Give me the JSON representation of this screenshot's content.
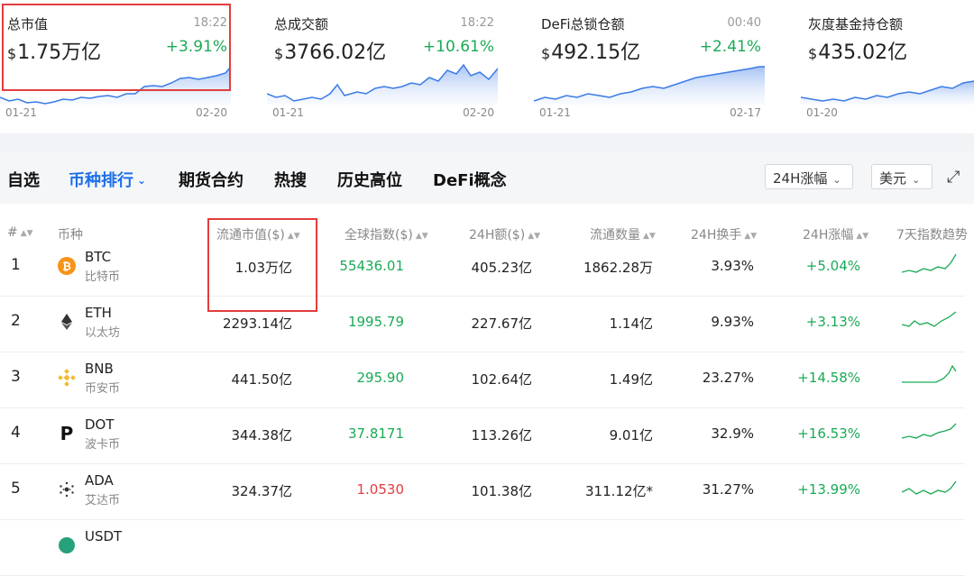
{
  "cards": [
    {
      "title": "总市值",
      "time": "18:22",
      "currency": "$",
      "value": "1.75万亿",
      "change": "+3.91%",
      "date_start": "01-21",
      "date_end": "02-20"
    },
    {
      "title": "总成交额",
      "time": "18:22",
      "currency": "$",
      "value": "3766.02亿",
      "change": "+10.61%",
      "date_start": "01-21",
      "date_end": "02-20"
    },
    {
      "title": "DeFi总锁仓额",
      "time": "00:40",
      "currency": "$",
      "value": "492.15亿",
      "change": "+2.41%",
      "date_start": "01-21",
      "date_end": "02-17"
    },
    {
      "title": "灰度基金持仓额",
      "time": "",
      "currency": "$",
      "value": "435.02亿",
      "change": "",
      "date_start": "01-20",
      "date_end": ""
    }
  ],
  "nav": {
    "tabs": [
      "自选",
      "币种排行",
      "期货合约",
      "热搜",
      "历史高位",
      "DeFi概念"
    ],
    "active_tab": "币种排行",
    "range_select": "24H涨幅",
    "currency_select": "美元"
  },
  "table": {
    "headers": [
      "#",
      "币种",
      "流通市值($)",
      "全球指数($)",
      "24H额($)",
      "流通数量",
      "24H换手",
      "24H涨幅",
      "7天指数趋势"
    ],
    "rows": [
      {
        "rank": "1",
        "symbol": "BTC",
        "name": "比特币",
        "market_cap": "1.03万亿",
        "price": "55436.01",
        "price_trend": "up",
        "volume": "405.23亿",
        "supply": "1862.28万",
        "turnover": "3.93%",
        "change": "+5.04%"
      },
      {
        "rank": "2",
        "symbol": "ETH",
        "name": "以太坊",
        "market_cap": "2293.14亿",
        "price": "1995.79",
        "price_trend": "up",
        "volume": "227.67亿",
        "supply": "1.14亿",
        "turnover": "9.93%",
        "change": "+3.13%"
      },
      {
        "rank": "3",
        "symbol": "BNB",
        "name": "币安币",
        "market_cap": "441.50亿",
        "price": "295.90",
        "price_trend": "up",
        "volume": "102.64亿",
        "supply": "1.49亿",
        "turnover": "23.27%",
        "change": "+14.58%"
      },
      {
        "rank": "4",
        "symbol": "DOT",
        "name": "波卡币",
        "market_cap": "344.38亿",
        "price": "37.8171",
        "price_trend": "up",
        "volume": "113.26亿",
        "supply": "9.01亿",
        "turnover": "32.9%",
        "change": "+16.53%"
      },
      {
        "rank": "5",
        "symbol": "ADA",
        "name": "艾达币",
        "market_cap": "324.37亿",
        "price": "1.0530",
        "price_trend": "down",
        "volume": "101.38亿",
        "supply": "311.12亿*",
        "turnover": "31.27%",
        "change": "+13.99%"
      },
      {
        "rank": "",
        "symbol": "USDT",
        "name": "",
        "market_cap": "",
        "price": "",
        "price_trend": "",
        "volume": "",
        "supply": "",
        "turnover": "",
        "change": ""
      }
    ]
  },
  "colors": {
    "accent": "#1c6fe8",
    "up": "#1aaa55",
    "down": "#e23d3d",
    "highlight": "#e23d3d"
  },
  "icons": {
    "btc": "bitcoin-icon",
    "eth": "ethereum-icon",
    "bnb": "binance-icon",
    "dot": "polkadot-icon",
    "ada": "cardano-icon"
  }
}
